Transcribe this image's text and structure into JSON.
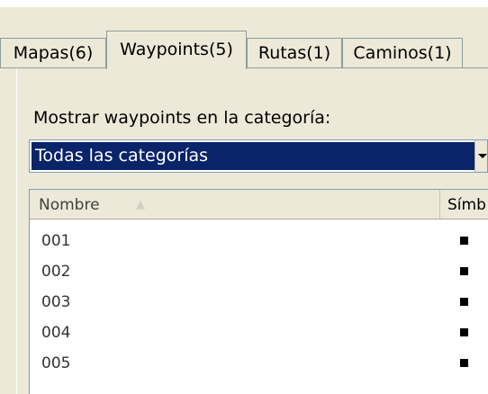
{
  "tabs": [
    {
      "label": "Mapas(6)",
      "active": false
    },
    {
      "label": "Waypoints(5)",
      "active": true
    },
    {
      "label": "Rutas(1)",
      "active": false
    },
    {
      "label": "Caminos(1)",
      "active": false
    }
  ],
  "category": {
    "label": "Mostrar waypoints en la categoría:",
    "selected": "Todas las categorías"
  },
  "list": {
    "columns": [
      "Nombre",
      "Símb"
    ],
    "rows": [
      {
        "name": "001",
        "symbol": "square-icon"
      },
      {
        "name": "002",
        "symbol": "square-icon"
      },
      {
        "name": "003",
        "symbol": "square-icon"
      },
      {
        "name": "004",
        "symbol": "square-icon"
      },
      {
        "name": "005",
        "symbol": "square-icon"
      }
    ]
  },
  "colors": {
    "selection": "#0a246a",
    "face": "#ece9d8"
  }
}
